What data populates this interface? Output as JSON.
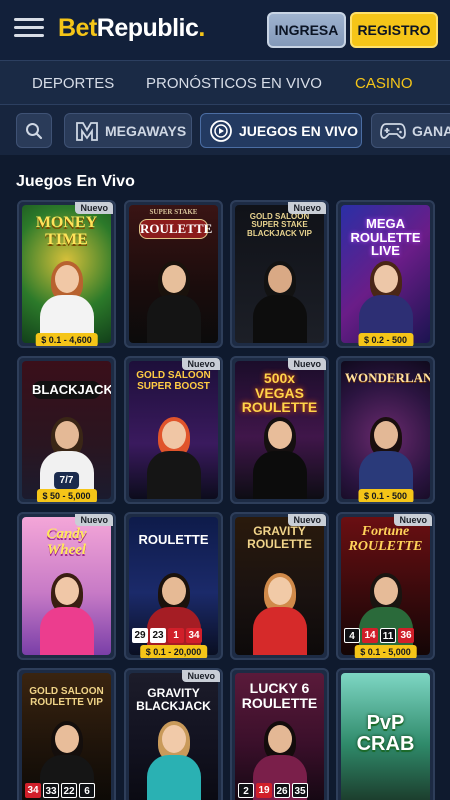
{
  "header": {
    "logo_bet": "Bet",
    "logo_republic": "Republic",
    "logo_dot": ".",
    "login_label": "INGRESA",
    "register_label": "REGISTRO"
  },
  "mainnav": [
    {
      "label": "DEPORTES",
      "active": false
    },
    {
      "label": "PRONÓSTICOS EN VIVO",
      "active": false
    },
    {
      "label": "CASINO",
      "active": true
    }
  ],
  "chips": [
    {
      "label": "",
      "icon": "search-icon"
    },
    {
      "label": "MEGAWAYS",
      "icon": "megaways-icon"
    },
    {
      "label": "JUEGOS EN VIVO",
      "icon": "live-games-icon",
      "active": true
    },
    {
      "label": "GANA",
      "icon": "gamepad-icon"
    }
  ],
  "section": {
    "title": "Juegos En Vivo"
  },
  "colors": {
    "accent": "#f5c518",
    "background": "#0f1a2e",
    "header": "#12203a"
  },
  "games": [
    {
      "title": "MONEY TIME",
      "badge": "Nuevo",
      "limit": "$ 0.1 - 4,600"
    },
    {
      "title": "ROULETTE",
      "subtitle": "SUPER STAKE",
      "badge": "",
      "limit": ""
    },
    {
      "title": "GOLD SALOON SUPER STAKE BLACKJACK VIP",
      "badge": "Nuevo",
      "limit": ""
    },
    {
      "title": "MEGA ROULETTE LIVE",
      "badge": "",
      "limit": "$ 0.2 - 500"
    },
    {
      "title": "BLACKJACK",
      "badge": "",
      "limit": "$ 50 - 5,000",
      "seats": "7/7"
    },
    {
      "title": "GOLD SALOON SUPER BOOST",
      "badge": "Nuevo",
      "limit": ""
    },
    {
      "title": "500x VEGAS ROULETTE",
      "badge": "Nuevo",
      "limit": ""
    },
    {
      "title": "WONDERLAND",
      "badge": "",
      "limit": "$ 0.1 - 500"
    },
    {
      "title": "Candy Wheel",
      "badge": "Nuevo",
      "limit": ""
    },
    {
      "title": "ROULETTE",
      "badge": "",
      "limit": "$ 0.1 - 20,000",
      "numbers": [
        "29",
        "23",
        "1",
        "34"
      ]
    },
    {
      "title": "GRAVITY ROULETTE",
      "badge": "Nuevo",
      "limit": ""
    },
    {
      "title": "Fortune ROULETTE",
      "badge": "Nuevo",
      "limit": "$ 0.1 - 5,000",
      "numbers": [
        "4",
        "14",
        "11",
        "36"
      ]
    },
    {
      "title": "GOLD SALOON ROULETTE VIP",
      "badge": "",
      "limit": "",
      "numbers": [
        "34",
        "33",
        "22",
        "6"
      ]
    },
    {
      "title": "GRAVITY BLACKJACK",
      "badge": "Nuevo",
      "limit": ""
    },
    {
      "title": "LUCKY 6 ROULETTE",
      "badge": "",
      "limit": "",
      "numbers": [
        "2",
        "19",
        "26",
        "35"
      ]
    },
    {
      "title": "PvP CRAB",
      "badge": "",
      "limit": ""
    }
  ]
}
